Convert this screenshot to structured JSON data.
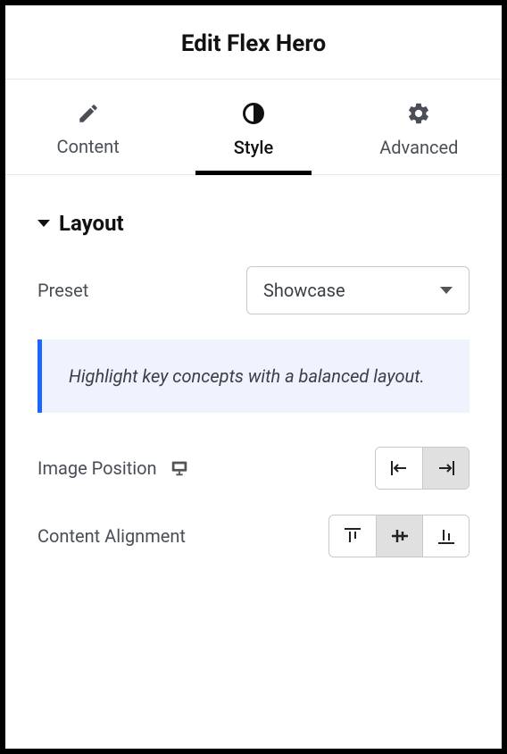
{
  "header": {
    "title": "Edit Flex Hero"
  },
  "tabs": {
    "items": [
      {
        "label": "Content"
      },
      {
        "label": "Style"
      },
      {
        "label": "Advanced"
      }
    ],
    "active": "Style"
  },
  "layout": {
    "section_title": "Layout",
    "preset": {
      "label": "Preset",
      "value": "Showcase"
    },
    "info_text": "Highlight key concepts with a balanced layout.",
    "image_position": {
      "label": "Image Position",
      "options": [
        "left",
        "right"
      ],
      "value": "right"
    },
    "content_alignment": {
      "label": "Content Alignment",
      "options": [
        "top",
        "middle",
        "bottom"
      ],
      "value": "middle"
    }
  }
}
